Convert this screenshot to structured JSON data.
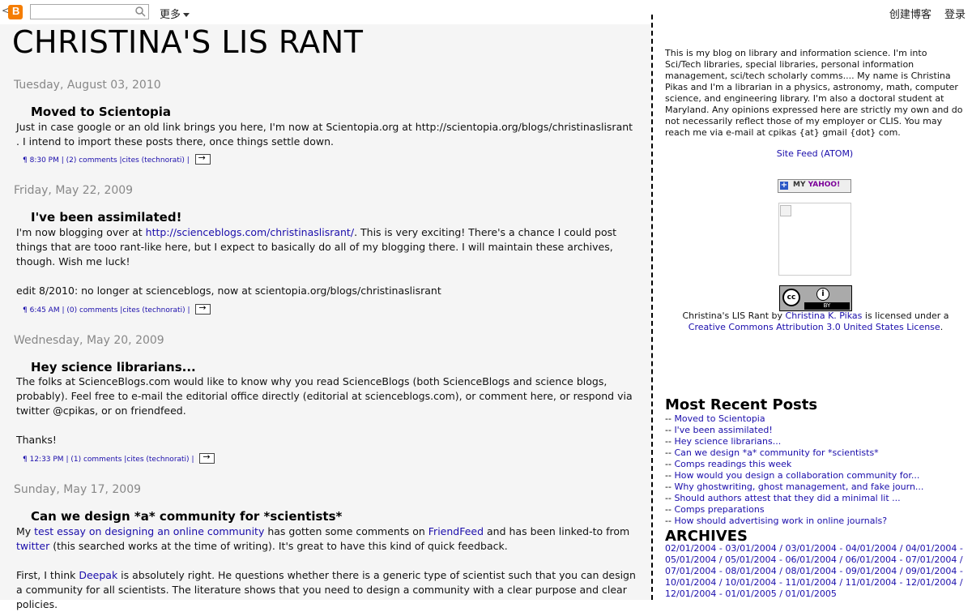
{
  "navbar": {
    "logo_icon": "blogger-logo-icon",
    "logo_letter": "B",
    "logo_text": "<",
    "search_placeholder": "",
    "more_label": "更多",
    "create_blog": "创建博客",
    "login": "登录"
  },
  "blog": {
    "title": "CHRISTINA'S LIS RANT"
  },
  "posts": [
    {
      "date": "Tuesday, August 03, 2010",
      "title": "Moved to Scientopia",
      "body": [
        "Just in case google or an old link brings you here, I'm now at Scientopia.org at http://scientopia.org/blogs/christinaslisrant . I intend to import these posts there, once things settle down."
      ],
      "time": "¶ 8:30 PM",
      "comments": "(2) comments",
      "cites": "cites (technorati)"
    },
    {
      "date": "Friday, May 22, 2009",
      "title": "I've been assimilated!",
      "body_prefix": "I'm now blogging over at ",
      "body_link": "http://scienceblogs.com/christinaslisrant/",
      "body_suffix": ". This is very exciting! There's a chance I could post things that are tooo rant-like here, but I expect to basically do all of my blogging there. I will maintain these archives, though. Wish me luck!",
      "body2": "edit 8/2010: no longer at scienceblogs, now at scientopia.org/blogs/christinaslisrant",
      "time": "¶ 6:45 AM",
      "comments": "(0) comments",
      "cites": "cites (technorati)"
    },
    {
      "date": "Wednesday, May 20, 2009",
      "title": "Hey science librarians...",
      "body": [
        "The folks at ScienceBlogs.com would like to know why you read ScienceBlogs (both ScienceBlogs and science blogs, probably). Feel free to e-mail the editorial office directly (editorial at scienceblogs.com), or comment here, or respond via twitter @cpikas, or on friendfeed.",
        "Thanks!"
      ],
      "time": "¶ 12:33 PM",
      "comments": "(1) comments",
      "cites": "cites (technorati)"
    },
    {
      "date": "Sunday, May 17, 2009",
      "title": "Can we design *a* community for *scientists*",
      "p1_a": "My ",
      "p1_link1": "test essay on designing an online community",
      "p1_b": " has gotten some comments on ",
      "p1_link2": "FriendFeed",
      "p1_c": " and has been linked-to from ",
      "p1_link3": "twitter",
      "p1_d": " (this searched works at the time of writing). It's great to have this kind of quick feedback.",
      "p2_a": "First, I think ",
      "p2_link": "Deepak",
      "p2_b": " is absolutely right. He questions whether there is a generic type of scientist such that you can design a community for all scientists. The literature shows that you need to design a community with a clear purpose and clear policies."
    }
  ],
  "sidebar": {
    "about": "This is my blog on library and information science. I'm into Sci/Tech libraries, special libraries, personal information management, sci/tech scholarly comms.... My name is Christina Pikas and I'm a librarian in a physics, astronomy, math, computer science, and engineering library. I'm also a doctoral student at Maryland. Any opinions expressed here are strictly my own and do not necessarily reflect those of my employer or CLIS. You may reach me via e-mail at cpikas {at} gmail {dot} com.",
    "site_feed": "Site Feed (ATOM)",
    "yahoo_my": "MY",
    "yahoo_brand": "YAHOO!",
    "cc_icon_1": "cc",
    "cc_icon_2": "i",
    "cc_by": "BY",
    "license_a": "Christina's LIS Rant",
    "license_b": " by ",
    "license_author": "Christina K. Pikas",
    "license_c": " is licensed under a ",
    "license_link": "Creative Commons Attribution 3.0 United States License",
    "license_d": ".",
    "recent_heading": "Most Recent Posts",
    "recent_posts": [
      "Moved to Scientopia",
      "I've been assimilated!",
      "Hey science librarians...",
      "Can we design *a* community for *scientists*",
      "Comps readings this week",
      "How would you design a collaboration community for...",
      "Why ghostwriting, ghost management, and fake journ...",
      "Should authors attest that they did a minimal lit ...",
      "Comps preparations",
      "How should advertising work in online journals?"
    ],
    "recent_prefix": "-- ",
    "archives_heading": "ARCHIVES",
    "archives": [
      "02/01/2004 - 03/01/2004",
      "03/01/2004 - 04/01/2004",
      "04/01/2004 - 05/01/2004",
      "05/01/2004 - 06/01/2004",
      "06/01/2004 - 07/01/2004",
      "07/01/2004 - 08/01/2004",
      "08/01/2004 - 09/01/2004",
      "09/01/2004 - 10/01/2004",
      "10/01/2004 - 11/01/2004",
      "11/01/2004 - 12/01/2004",
      "12/01/2004 - 01/01/2005",
      "01/01/2005"
    ],
    "archive_sep": " / "
  },
  "colors": {
    "link": "#1a0dab",
    "date": "#888888",
    "main_bg": "#f5f5f5",
    "logo": "#f57d00"
  }
}
